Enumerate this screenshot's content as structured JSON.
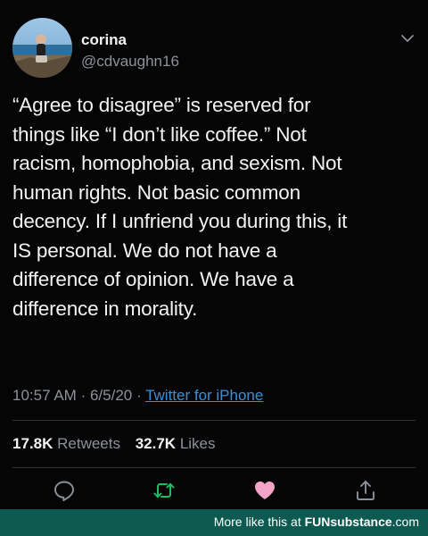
{
  "user": {
    "display_name": "corina",
    "handle": "@cdvaughn16"
  },
  "tweet": {
    "lines": [
      "“Agree to disagree” is reserved for",
      "things like “I don’t like coffee.” Not",
      "racism, homophobia, and sexism. Not",
      "human rights. Not basic common",
      "decency. If I unfriend you during this, it",
      "IS personal. We do not have a",
      "difference of opinion. We have a",
      "difference in morality."
    ],
    "time": "10:57 AM",
    "date": "6/5/20",
    "separator": "·",
    "source": "Twitter for iPhone"
  },
  "stats": {
    "retweets_count": "17.8K",
    "retweets_label": "Retweets",
    "likes_count": "32.7K",
    "likes_label": "Likes"
  },
  "icons": {
    "reply": "reply-icon",
    "retweet": "retweet-icon",
    "like": "heart-icon",
    "share": "share-icon",
    "menu": "chevron-down-icon"
  },
  "colors": {
    "background": "#050505",
    "retweet_icon": "#17bf63",
    "like_icon": "#f4a4c6",
    "link": "#3a8fd6",
    "footer_bg": "#0d5a50"
  },
  "footer": {
    "prefix": "More like this at ",
    "brand": "FUNsubstance",
    "suffix": ".com"
  }
}
